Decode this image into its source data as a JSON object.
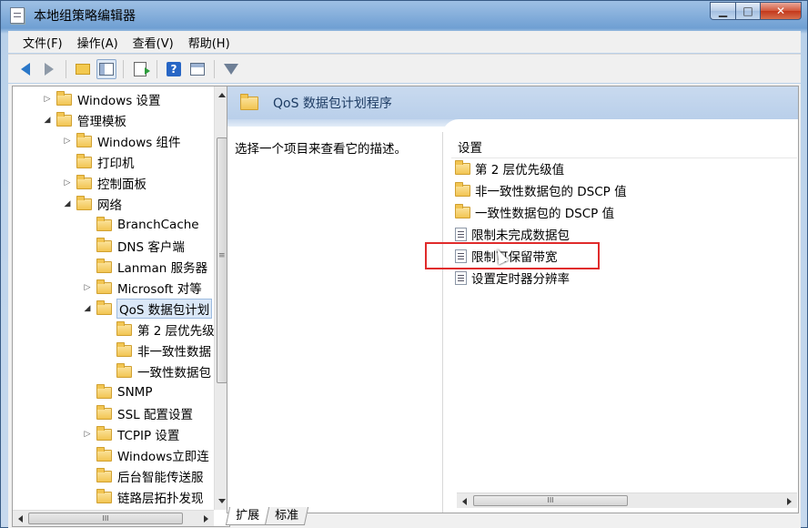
{
  "window": {
    "title": "本地组策略编辑器"
  },
  "window_buttons": {
    "minimize": "▁",
    "maximize": "□",
    "close": "✕"
  },
  "menu": [
    {
      "label": "文件(F)"
    },
    {
      "label": "操作(A)"
    },
    {
      "label": "查看(V)"
    },
    {
      "label": "帮助(H)"
    }
  ],
  "toolbar": {
    "icons": [
      "back-icon",
      "forward-icon",
      "up-folder-icon",
      "show-hide-tree-icon",
      "export-list-icon",
      "help-icon",
      "properties-icon",
      "filter-icon"
    ]
  },
  "tree": {
    "items": [
      {
        "label": "Windows 设置",
        "expander": "▷"
      },
      {
        "label": "管理模板",
        "expander": "◢"
      },
      {
        "label": "Windows 组件",
        "expander": "▷"
      },
      {
        "label": "打印机",
        "expander": ""
      },
      {
        "label": "控制面板",
        "expander": "▷"
      },
      {
        "label": "网络",
        "expander": "◢"
      },
      {
        "label": "BranchCache",
        "expander": ""
      },
      {
        "label": "DNS 客户端",
        "expander": ""
      },
      {
        "label": "Lanman 服务器",
        "expander": ""
      },
      {
        "label": "Microsoft 对等",
        "expander": "▷"
      },
      {
        "label": "QoS 数据包计划",
        "expander": "◢"
      },
      {
        "label": "第 2 层优先级",
        "expander": ""
      },
      {
        "label": "非一致性数据",
        "expander": ""
      },
      {
        "label": "一致性数据包",
        "expander": ""
      },
      {
        "label": "SNMP",
        "expander": ""
      },
      {
        "label": "SSL 配置设置",
        "expander": ""
      },
      {
        "label": "TCPIP 设置",
        "expander": "▷"
      },
      {
        "label": "Windows立即连",
        "expander": ""
      },
      {
        "label": "后台智能传送服",
        "expander": ""
      },
      {
        "label": "链路层拓扑发现",
        "expander": ""
      }
    ],
    "scroll_grip": "≡",
    "hscroll_grip": "III"
  },
  "right": {
    "header_title": "QoS 数据包计划程序",
    "description": "选择一个项目来查看它的描述。",
    "column_header": "设置",
    "settings": [
      {
        "label": "第 2 层优先级值",
        "kind": "folder"
      },
      {
        "label": "非一致性数据包的 DSCP 值",
        "kind": "folder"
      },
      {
        "label": "一致性数据包的 DSCP 值",
        "kind": "folder"
      },
      {
        "label": "限制未完成数据包",
        "kind": "setting"
      },
      {
        "label": "限制可保留带宽",
        "kind": "setting"
      },
      {
        "label": "设置定时器分辨率",
        "kind": "setting"
      }
    ],
    "hscroll_grip": "III"
  },
  "tabs": [
    {
      "label": "扩展"
    },
    {
      "label": "标准"
    }
  ],
  "colors": {
    "highlight": "#e02b2b",
    "header_bg": "#c9daef",
    "folder": "#f2c552"
  }
}
